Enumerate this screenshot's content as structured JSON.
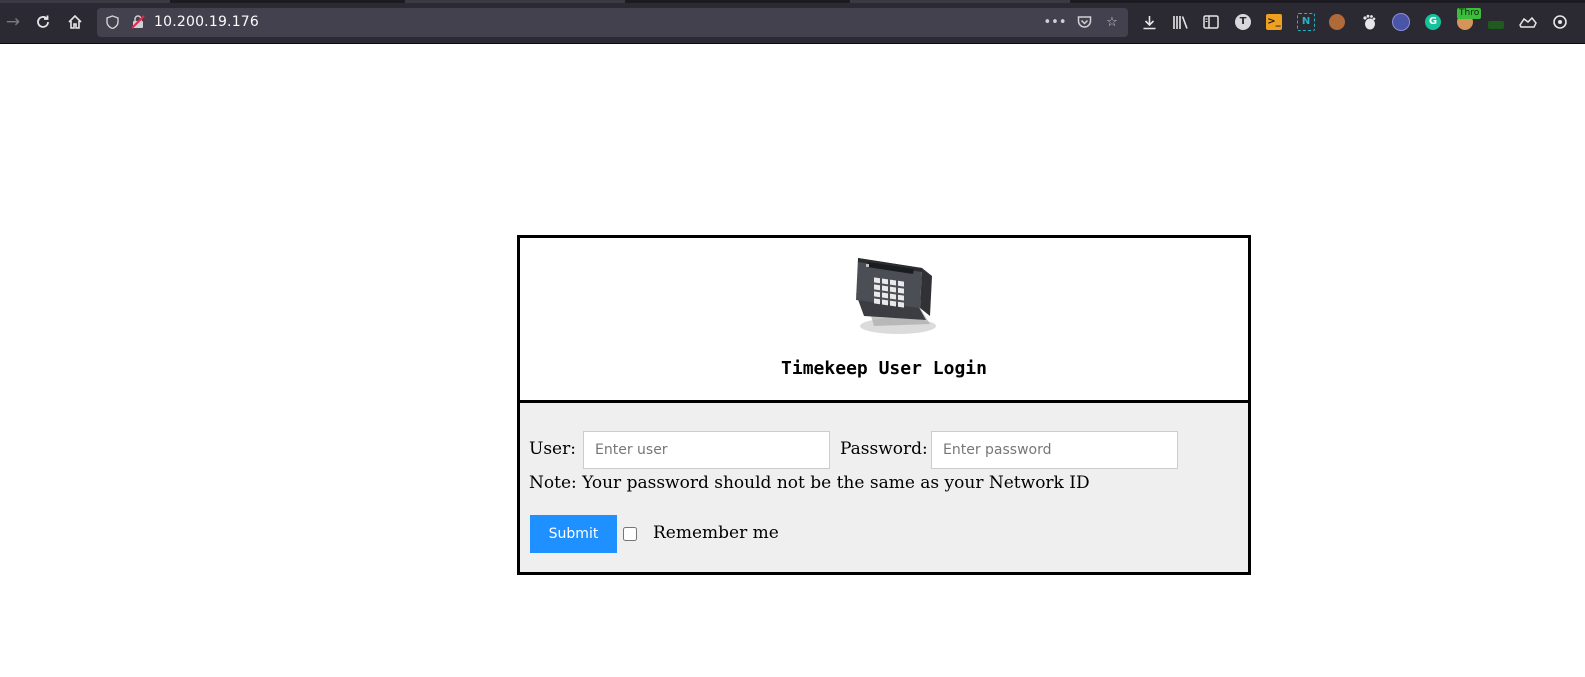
{
  "browser": {
    "url": "10.200.19.176",
    "extensions": {
      "tabliss_letter": "T",
      "nimbus_letter": "N",
      "grammarly_letter": "G",
      "throttle_badge": "Thro"
    }
  },
  "login": {
    "title": "Timekeep User Login",
    "user_label": "User:",
    "user_placeholder": "Enter user",
    "password_label": "Password:",
    "password_placeholder": "Enter password",
    "note": "Note: Your password should not be the same as your Network ID",
    "submit_label": "Submit",
    "remember_label": "Remember me",
    "remember_checked": false
  },
  "colors": {
    "submit_bg": "#1e90ff",
    "form_bg": "#efefef",
    "toolbar_bg": "#2b2a33"
  }
}
